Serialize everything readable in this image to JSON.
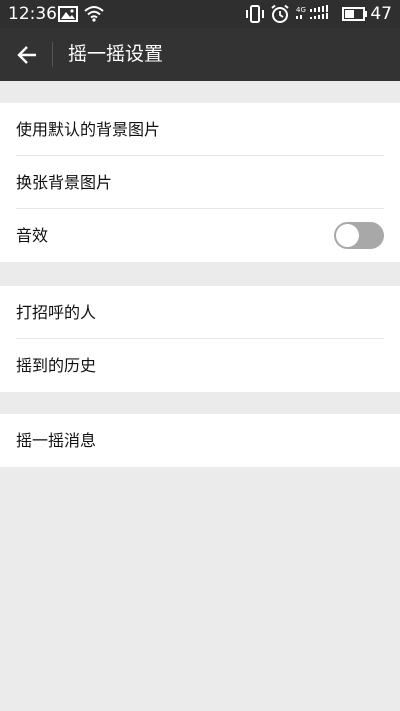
{
  "status_bar": {
    "time": "12:36",
    "network_label": "4G",
    "battery_level": "47",
    "icons": [
      "image-icon",
      "wifi-icon",
      "vibrate-icon",
      "alarm-icon",
      "cellular-signal-icon",
      "battery-icon"
    ]
  },
  "toolbar": {
    "title": "摇一摇设置",
    "back_icon": "arrow-left-icon"
  },
  "settings": {
    "group1": [
      {
        "label": "使用默认的背景图片"
      },
      {
        "label": "换张背景图片"
      },
      {
        "label": "音效",
        "toggle_on": false
      }
    ],
    "group2": [
      {
        "label": "打招呼的人"
      },
      {
        "label": "摇到的历史"
      }
    ],
    "group3": [
      {
        "label": "摇一摇消息"
      }
    ]
  },
  "colors": {
    "status_bar_bg": "#2f2f2f",
    "toolbar_bg": "#333333",
    "page_bg": "#ebebeb",
    "toggle_off": "#a8a8a8"
  }
}
